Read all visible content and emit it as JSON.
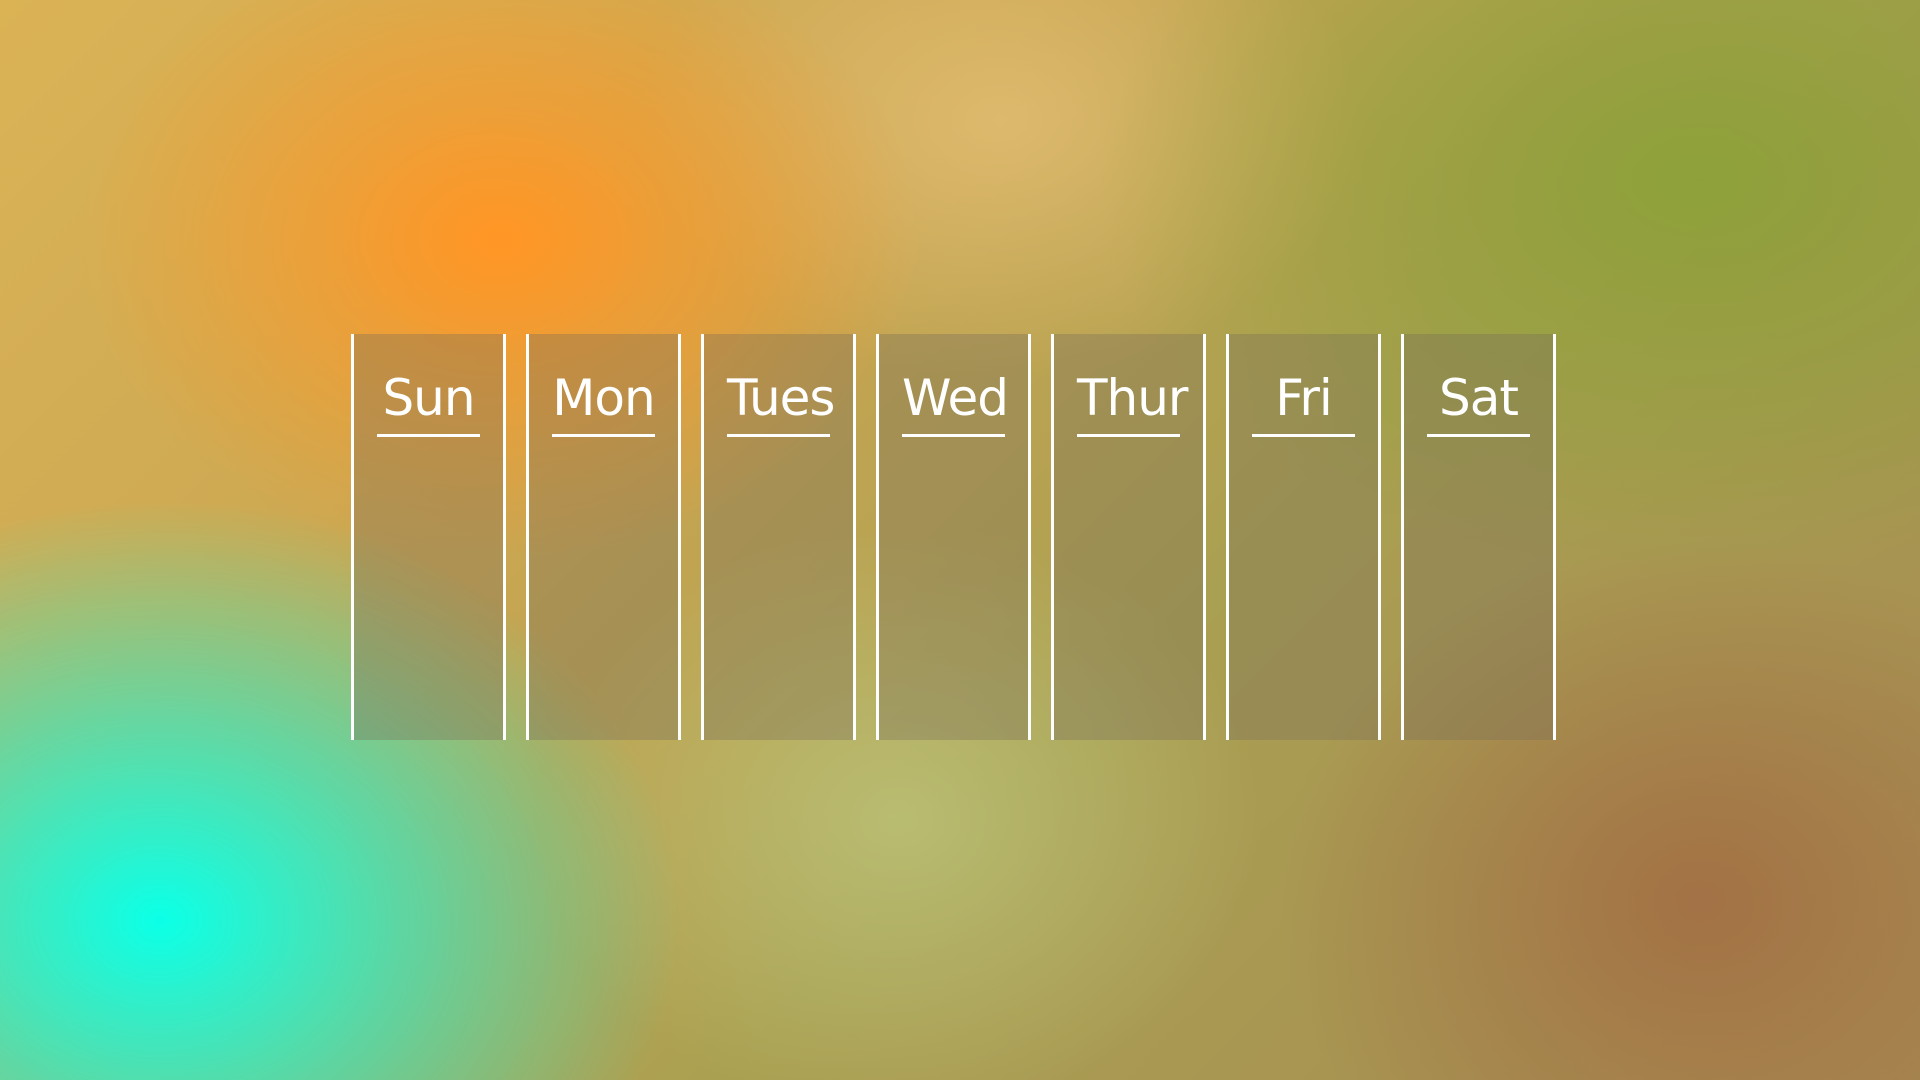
{
  "days": [
    {
      "label": "Sun"
    },
    {
      "label": "Mon"
    },
    {
      "label": "Tues"
    },
    {
      "label": "Wed"
    },
    {
      "label": "Thur"
    },
    {
      "label": "Fri"
    },
    {
      "label": "Sat"
    }
  ]
}
